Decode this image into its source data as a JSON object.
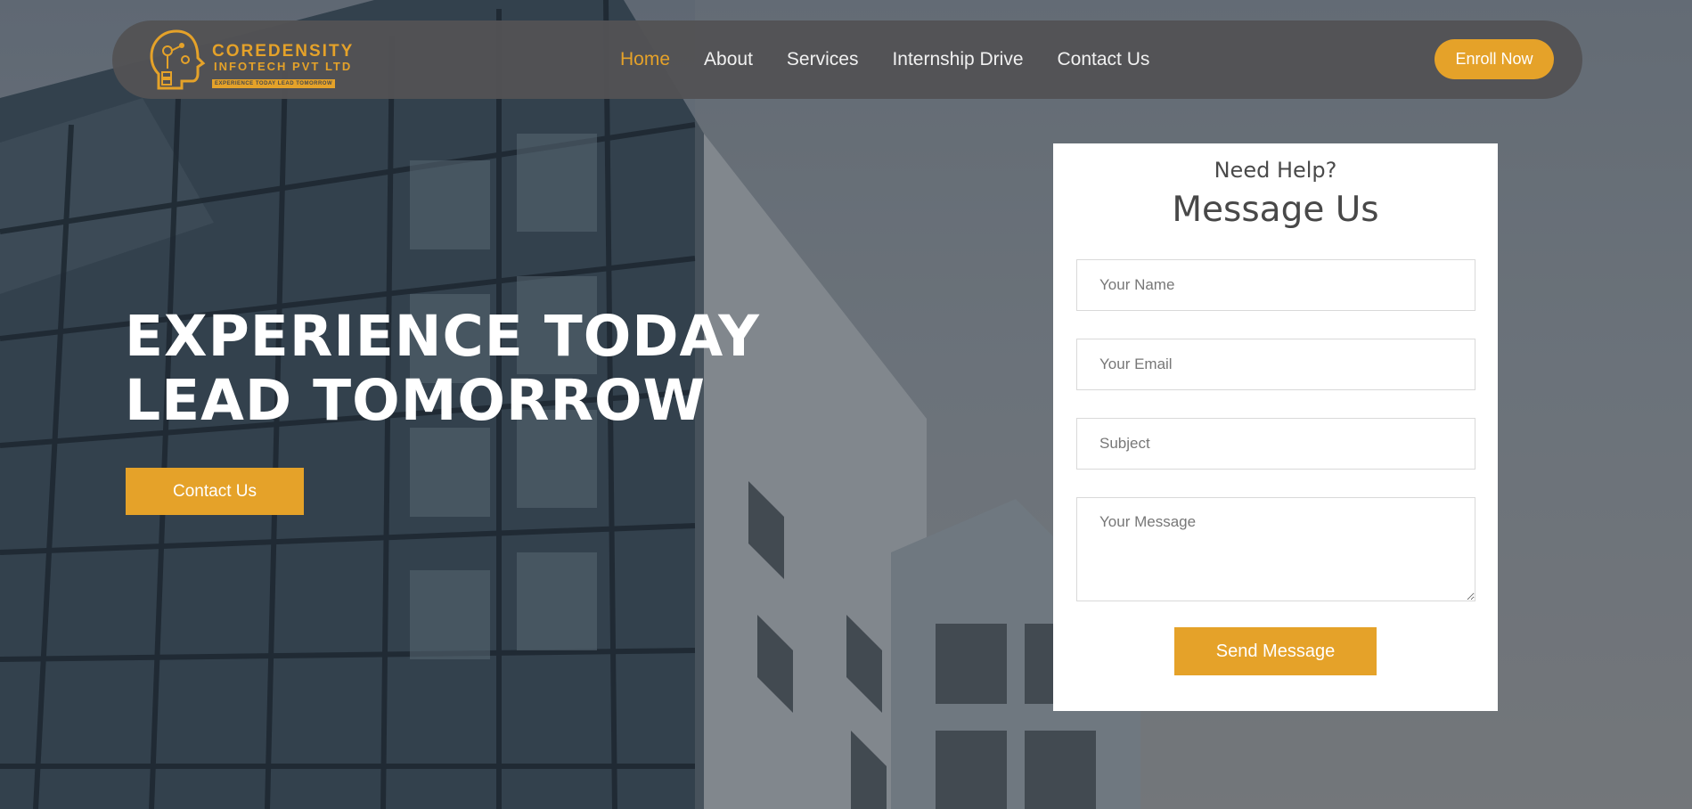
{
  "brand": {
    "name_line1": "COREDENSITY",
    "name_line2": "INFOTECH PVT LTD",
    "tagline": "EXPERIENCE TODAY LEAD TOMORROW",
    "logo_icon": "robot-head-icon"
  },
  "nav": {
    "items": [
      {
        "label": "Home",
        "active": true
      },
      {
        "label": "About",
        "active": false
      },
      {
        "label": "Services",
        "active": false
      },
      {
        "label": "Internship Drive",
        "active": false
      },
      {
        "label": "Contact Us",
        "active": false
      }
    ],
    "enroll_label": "Enroll Now"
  },
  "hero": {
    "title_line1": "EXPERIENCE TODAY",
    "title_line2": "LEAD TOMORROW",
    "cta_label": "Contact Us"
  },
  "form": {
    "kicker": "Need Help?",
    "title": "Message Us",
    "name_placeholder": "Your Name",
    "email_placeholder": "Your Email",
    "subject_placeholder": "Subject",
    "message_placeholder": "Your Message",
    "submit_label": "Send Message"
  },
  "colors": {
    "accent": "#e5a229",
    "header_bg": "#525254",
    "text_dark": "#484848"
  }
}
